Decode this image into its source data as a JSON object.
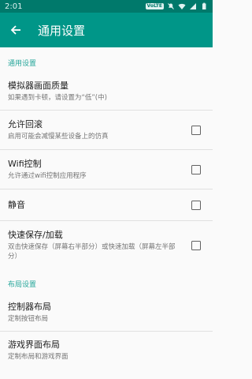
{
  "status_bar": {
    "time": "2:01",
    "badge": "VoLTE"
  },
  "app_bar": {
    "title": "通用设置"
  },
  "sections": [
    {
      "header": "通用设置",
      "items": [
        {
          "title": "模拟器画面质量",
          "summary": "如果遇到卡顿，请设置为“低”(中)",
          "checkbox": false
        },
        {
          "title": "允许回滚",
          "summary": "启用可能会减慢某些设备上的仿真",
          "checkbox": true,
          "checked": false
        },
        {
          "title": "Wifi控制",
          "summary": "允许通过wifi控制应用程序",
          "checkbox": true,
          "checked": false
        },
        {
          "title": "静音",
          "summary": "",
          "checkbox": true,
          "checked": false
        },
        {
          "title": "快速保存/加载",
          "summary": "双击快速保存（屏幕右半部分）或快速加载（屏幕左半部分）",
          "checkbox": true,
          "checked": false
        }
      ]
    },
    {
      "header": "布局设置",
      "items": [
        {
          "title": "控制器布局",
          "summary": "定制按钮布局",
          "checkbox": false
        },
        {
          "title": "游戏界面布局",
          "summary": "定制布局和游戏界面",
          "checkbox": false
        }
      ]
    }
  ]
}
